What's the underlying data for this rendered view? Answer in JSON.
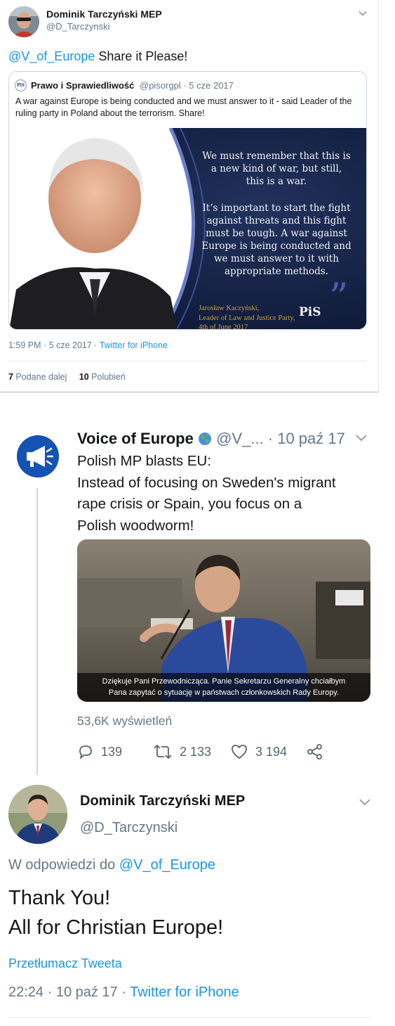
{
  "tweet1": {
    "author_name": "Dominik Tarczyński MEP",
    "author_handle": "@D_Tarczynski",
    "mention": "@V_of_Europe",
    "text": " Share it Please!",
    "quoted": {
      "author_name": "Prawo i Sprawiedliwość",
      "author_handle": "@pisorgpl · 5 cze 2017",
      "text": "A war against Europe is being conducted and we must answer to it - said Leader of the ruling party in Poland about the terrorism. Share!",
      "image_quote": [
        "We must remember that this is",
        "a new kind of war, but still,",
        "this is a war.",
        "It’s important to start the fight",
        "against threats and this fight",
        "must be tough. A war against",
        "Europe is being conducted and",
        "we must answer to it with",
        "appropriate methods."
      ],
      "image_signature": [
        "Jarosław Kaczyński,",
        "Leader of Law and Justice Party,",
        "4th of June 2017"
      ],
      "image_logo": "PiS",
      "logo_small": "PiS"
    },
    "time": "1:59 PM · 5 cze 2017 · ",
    "source": "Twitter for iPhone",
    "retweets_count": "7",
    "retweets_label": " Podane dalej",
    "likes_count": "10",
    "likes_label": " Polubień"
  },
  "tweet2": {
    "author_name": "Voice of Europe",
    "handle_date": " @V_... · 10 paź 17",
    "text_lines": [
      "Polish MP blasts EU:",
      "Instead of focusing on Sweden's migrant",
      "rape crisis or Spain, you focus on a",
      "Polish woodworm!"
    ],
    "video_caption_1": "Dziękuje Pani Przewodnicząca. Panie Sekretarzu Generalny chciałbym",
    "video_caption_2": "Pana zapytać o sytuację w państwach członkowskich Rady Europy.",
    "views": "53,6K wyświetleń",
    "replies": "139",
    "retweets": "2 133",
    "likes": "3 194"
  },
  "tweet3": {
    "author_name": "Dominik Tarczyński MEP",
    "author_handle": "@D_Tarczynski",
    "reply_prefix": "W odpowiedzi do ",
    "reply_to": "@V_of_Europe",
    "text_line1": "Thank You!",
    "text_line2": "All for Christian Europe!",
    "translate": "Przetłumacz Tweeta",
    "time": "22:24 · 10 paź 17 · ",
    "source": "Twitter for iPhone"
  },
  "colors": {
    "link": "#1b95e0",
    "muted": "#657786",
    "voe_blue": "#1452b4"
  },
  "icons": [
    "chevron-down-icon",
    "globe-emoji-icon",
    "megaphone-icon",
    "reply-icon",
    "retweet-icon",
    "heart-icon",
    "share-icon"
  ]
}
